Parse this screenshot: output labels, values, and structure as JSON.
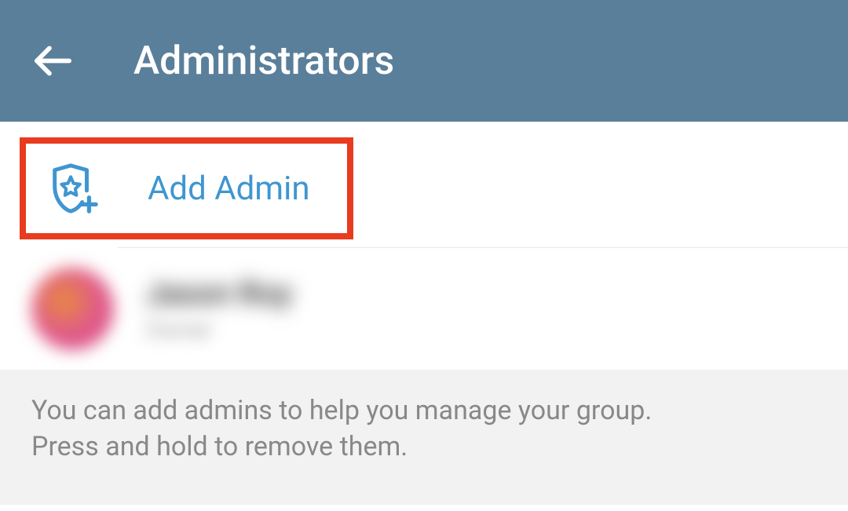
{
  "header": {
    "title": "Administrators"
  },
  "actions": {
    "add_admin_label": "Add Admin"
  },
  "admins": [
    {
      "name": "Jason Roy",
      "role": "Owner"
    }
  ],
  "footer": {
    "line1": "You can add admins to help you manage your group.",
    "line2": "Press and hold to remove them."
  }
}
